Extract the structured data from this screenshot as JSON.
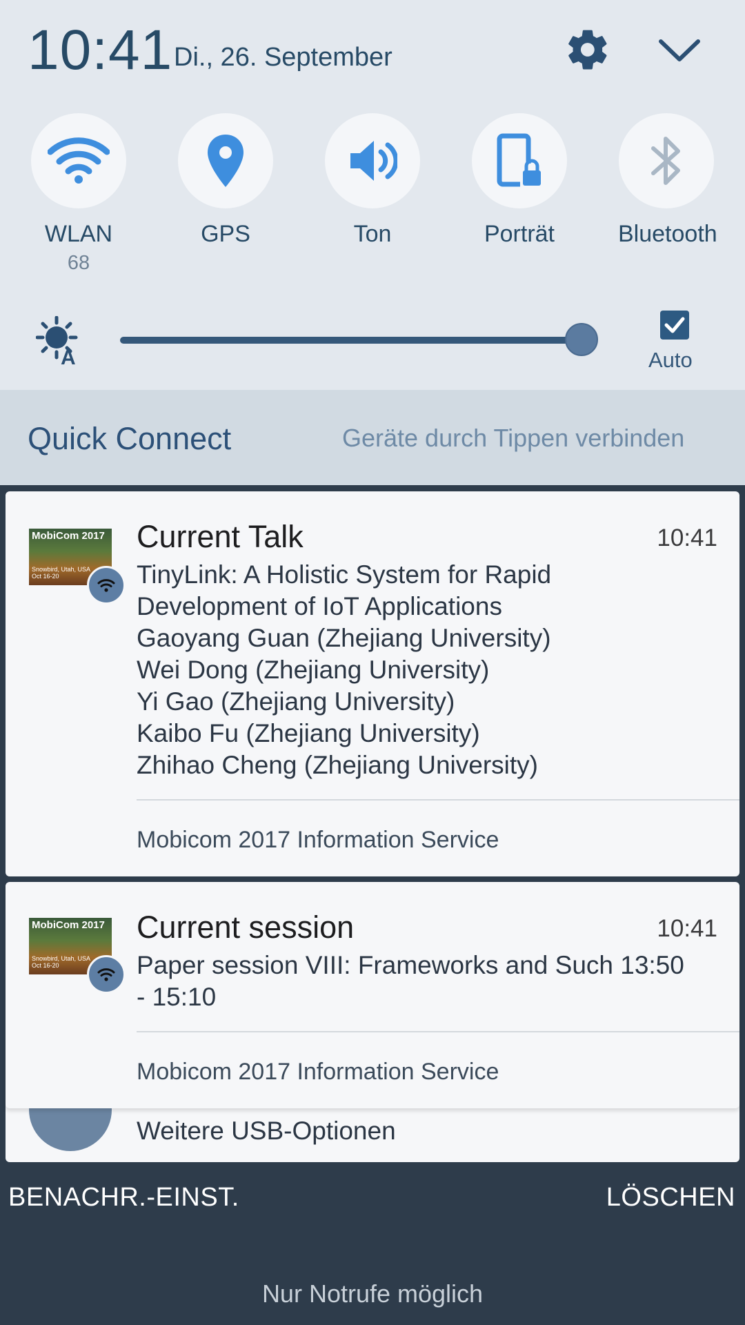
{
  "status": {
    "time": "10:41",
    "date": "Di., 26. September"
  },
  "tiles": [
    {
      "label": "WLAN",
      "sub": "68",
      "icon": "wifi-icon"
    },
    {
      "label": "GPS",
      "icon": "location-icon"
    },
    {
      "label": "Ton",
      "icon": "volume-icon"
    },
    {
      "label": "Porträt",
      "icon": "rotation-lock-icon"
    },
    {
      "label": "Bluetooth",
      "icon": "bluetooth-icon"
    }
  ],
  "brightness": {
    "level": 0.97,
    "auto_label": "Auto",
    "auto_checked": true
  },
  "quick_connect": {
    "title": "Quick Connect",
    "hint": "Geräte durch Tippen verbinden"
  },
  "notifications": [
    {
      "title": "Current Talk",
      "time": "10:41",
      "body": [
        "TinyLink: A Holistic System for Rapid",
        "Development of IoT Applications",
        "Gaoyang Guan (Zhejiang University)",
        "Wei Dong (Zhejiang University)",
        "Yi Gao (Zhejiang University)",
        "Kaibo Fu (Zhejiang University)",
        "Zhihao Cheng (Zhejiang University)"
      ],
      "app": "Mobicom 2017 Information Service",
      "thumb_title": "MobiCom 2017",
      "thumb_sub": "Snowbird, Utah, USA\nOct 16-20"
    },
    {
      "title": "Current session",
      "time": "10:41",
      "body": [
        "Paper session VIII: Frameworks and Such 13:50",
        "- 15:10"
      ],
      "app": "Mobicom 2017 Information Service",
      "thumb_title": "MobiCom 2017",
      "thumb_sub": "Snowbird, Utah, USA\nOct 16-20"
    }
  ],
  "usb": {
    "label": "Weitere USB-Optionen"
  },
  "actions": {
    "settings": "BENACHR.-EINST.",
    "clear": "LÖSCHEN"
  },
  "emergency": "Nur Notrufe möglich",
  "colors": {
    "accent": "#3e8ede",
    "panel": "#e3e8ee",
    "shade": "#2e3c4b"
  }
}
